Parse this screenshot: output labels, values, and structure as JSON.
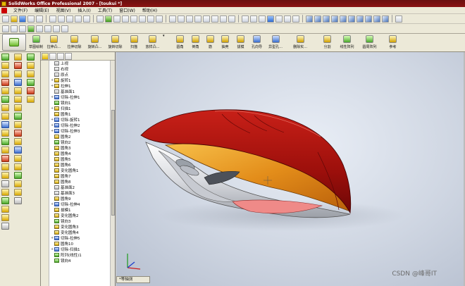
{
  "window": {
    "title": "SolidWorks Office Professional 2007 - [toukui *]"
  },
  "menu": [
    "文件(F)",
    "编辑(E)",
    "视图(V)",
    "插入(I)",
    "工具(T)",
    "窗口(W)",
    "帮助(H)"
  ],
  "features_toolbar": {
    "sketch_label": "草图绘制",
    "items": [
      "拉伸凸...",
      "拉伸切除",
      "旋转凸...",
      "旋转切除",
      "扫描",
      "放样凸...",
      "圆角",
      "倒角",
      "筋",
      "抽壳",
      "拔模",
      "孔向导",
      "异型孔...",
      "删除实...",
      "分割",
      "线性阵列",
      "圆周阵列",
      "参考"
    ]
  },
  "feature_tree": {
    "items": [
      {
        "label": "上视",
        "icon": "plane-icon",
        "expand": ""
      },
      {
        "label": "右视",
        "icon": "plane-icon",
        "expand": ""
      },
      {
        "label": "原点",
        "icon": "origin-icon",
        "expand": ""
      },
      {
        "label": "旋转1",
        "icon": "revolve-icon",
        "expand": "+"
      },
      {
        "label": "拉伸1",
        "icon": "extrude-icon",
        "expand": "+"
      },
      {
        "label": "基准面1",
        "icon": "plane-icon",
        "expand": ""
      },
      {
        "label": "切除-拉伸1",
        "icon": "cut-icon",
        "expand": "+"
      },
      {
        "label": "镜向1",
        "icon": "mirror-icon",
        "expand": ""
      },
      {
        "label": "扫描1",
        "icon": "sweep-icon",
        "expand": "+"
      },
      {
        "label": "圆角1",
        "icon": "fillet-icon",
        "expand": ""
      },
      {
        "label": "切除-旋转1",
        "icon": "cut-icon",
        "expand": "+"
      },
      {
        "label": "切除-拉伸2",
        "icon": "cut-icon",
        "expand": "+"
      },
      {
        "label": "切除-拉伸3",
        "icon": "cut-icon",
        "expand": "+"
      },
      {
        "label": "圆角2",
        "icon": "fillet-icon",
        "expand": ""
      },
      {
        "label": "镜向2",
        "icon": "mirror-icon",
        "expand": ""
      },
      {
        "label": "圆角3",
        "icon": "fillet-icon",
        "expand": ""
      },
      {
        "label": "圆角4",
        "icon": "fillet-icon",
        "expand": ""
      },
      {
        "label": "圆角5",
        "icon": "fillet-icon",
        "expand": ""
      },
      {
        "label": "圆角6",
        "icon": "fillet-icon",
        "expand": ""
      },
      {
        "label": "变化圆角1",
        "icon": "fillet-icon",
        "expand": ""
      },
      {
        "label": "圆角7",
        "icon": "fillet-icon",
        "expand": ""
      },
      {
        "label": "圆角8",
        "icon": "fillet-icon",
        "expand": ""
      },
      {
        "label": "基准面2",
        "icon": "plane-icon",
        "expand": ""
      },
      {
        "label": "基准面3",
        "icon": "plane-icon",
        "expand": ""
      },
      {
        "label": "圆角9",
        "icon": "fillet-icon",
        "expand": ""
      },
      {
        "label": "切除-拉伸4",
        "icon": "cut-icon",
        "expand": "+"
      },
      {
        "label": "拔模1",
        "icon": "draft-icon",
        "expand": ""
      },
      {
        "label": "变化圆角2",
        "icon": "fillet-icon",
        "expand": ""
      },
      {
        "label": "镜向3",
        "icon": "mirror-icon",
        "expand": ""
      },
      {
        "label": "变化圆角3",
        "icon": "fillet-icon",
        "expand": ""
      },
      {
        "label": "变化圆角4",
        "icon": "fillet-icon",
        "expand": ""
      },
      {
        "label": "切除-拉伸5",
        "icon": "cut-icon",
        "expand": "+"
      },
      {
        "label": "圆角10",
        "icon": "fillet-icon",
        "expand": ""
      },
      {
        "label": "切除-扫描1",
        "icon": "cut-icon",
        "expand": "+"
      },
      {
        "label": "阵列(线性)1",
        "icon": "pattern-icon",
        "expand": ""
      },
      {
        "label": "镜向4",
        "icon": "mirror-icon",
        "expand": ""
      }
    ]
  },
  "viewport": {
    "view_name": "*等轴测",
    "background": "#cfd6e2"
  },
  "watermark": "CSDN @峰哥IT",
  "colors": {
    "title_bar": "#8a1212",
    "shell_red": "#a8120d",
    "shell_orange": "#e38d1a",
    "body_silver": "#d9dbe0",
    "vent_pink": "#ef8a88"
  }
}
